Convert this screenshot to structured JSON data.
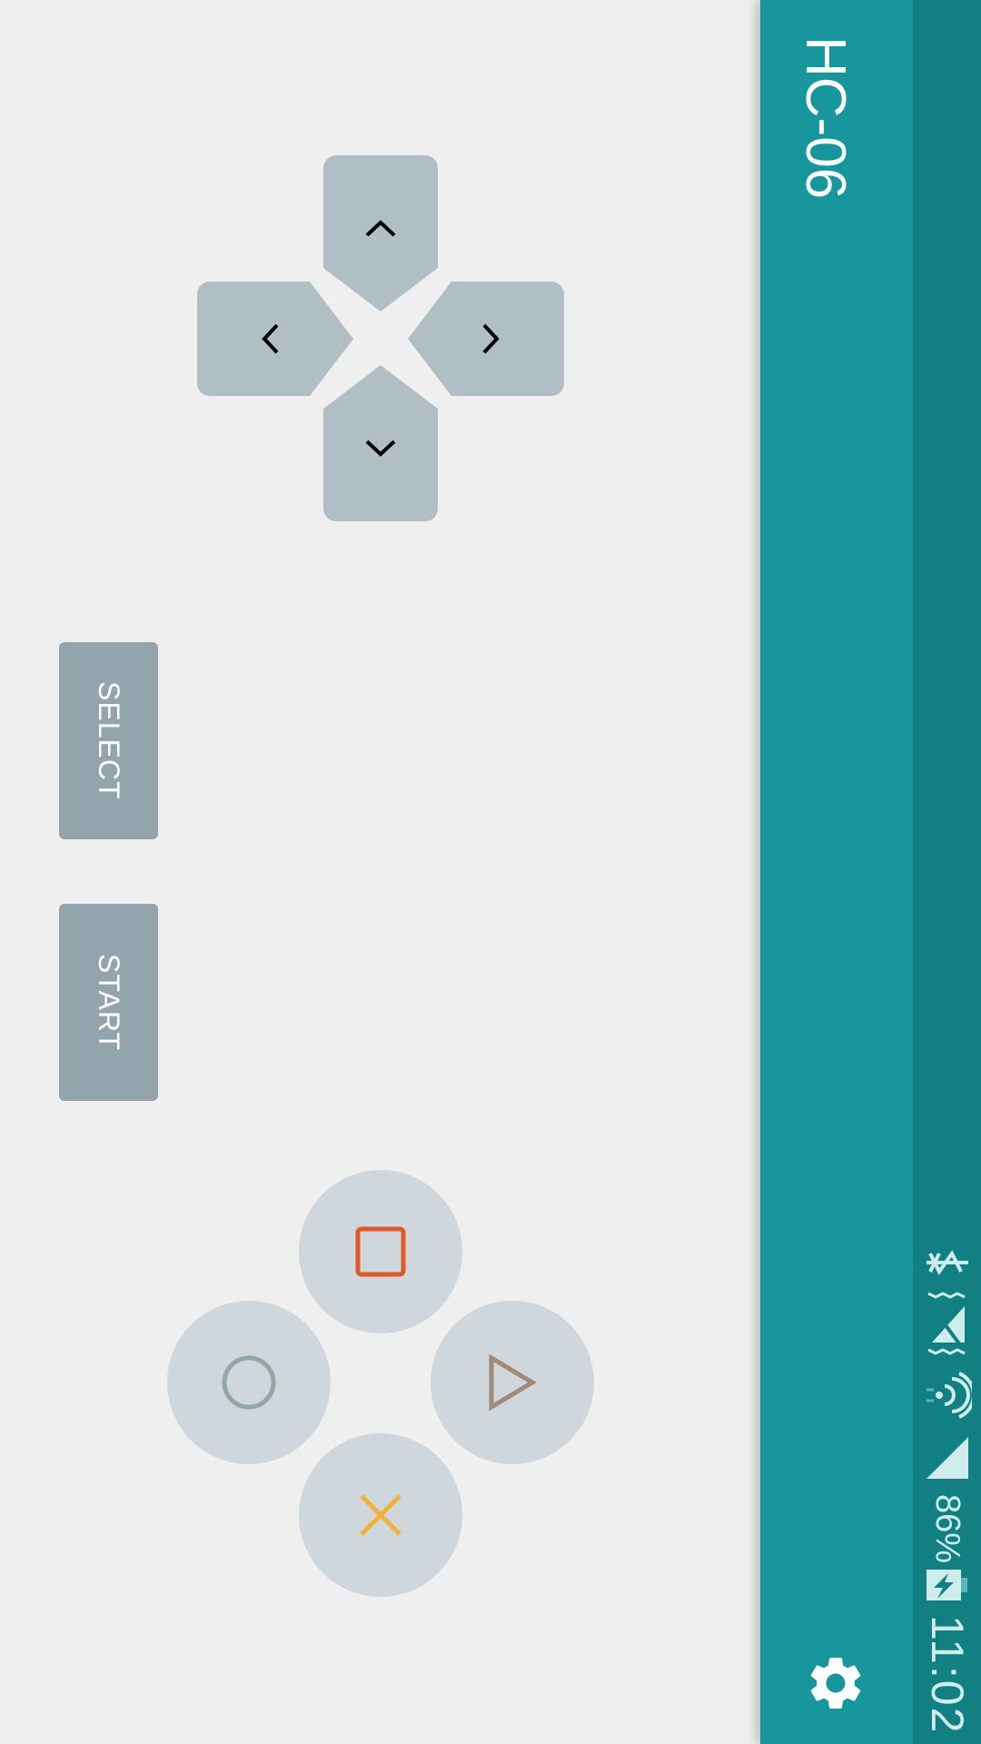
{
  "app": {
    "title": "HC-06"
  },
  "status_bar": {
    "time": "11:02",
    "battery": "86%"
  },
  "controls": {
    "select_label": "SELECT",
    "start_label": "START"
  },
  "colors": {
    "app_bar": "#17979b",
    "status_bar": "#128083",
    "square": "#e0572a",
    "circle": "#95a7a4",
    "triangle": "#a08a78",
    "cross": "#f0b23a"
  }
}
